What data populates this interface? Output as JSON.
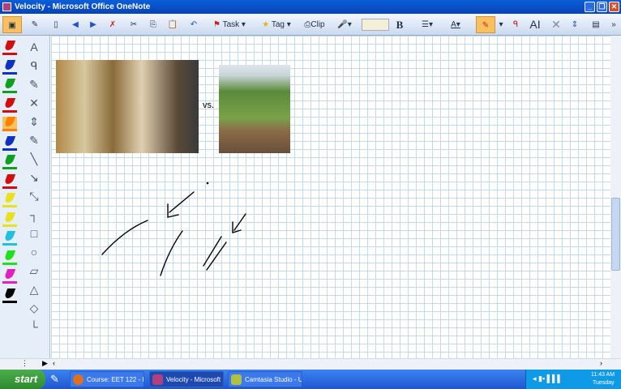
{
  "window": {
    "title": "Velocity - Microsoft Office OneNote"
  },
  "toolbar": {
    "task_label": "Task",
    "tag_label": "Tag",
    "clip_label": "Clip",
    "bold_label": "B"
  },
  "canvas": {
    "vs_text": "vs.",
    "images": [
      {
        "name": "crowded-subway-platform-photo"
      },
      {
        "name": "runner-on-trail-photo"
      }
    ]
  },
  "pens": {
    "colors": [
      "#d01010",
      "#1030c0",
      "#10a020",
      "#d01010",
      "#ff8000",
      "#1030c0",
      "#10a020",
      "#d01010",
      "#e8e020",
      "#e8e020",
      "#20c0e0",
      "#20e020",
      "#e020c0",
      "#000000"
    ]
  },
  "taskbar": {
    "start_label": "start",
    "tasks": [
      {
        "label": "Course: EET 122 - I..."
      },
      {
        "label": "Velocity - Microsoft ..."
      },
      {
        "label": "Camtasia Studio - U..."
      }
    ],
    "clock_time": "11:43 AM",
    "clock_day": "Tuesday"
  }
}
